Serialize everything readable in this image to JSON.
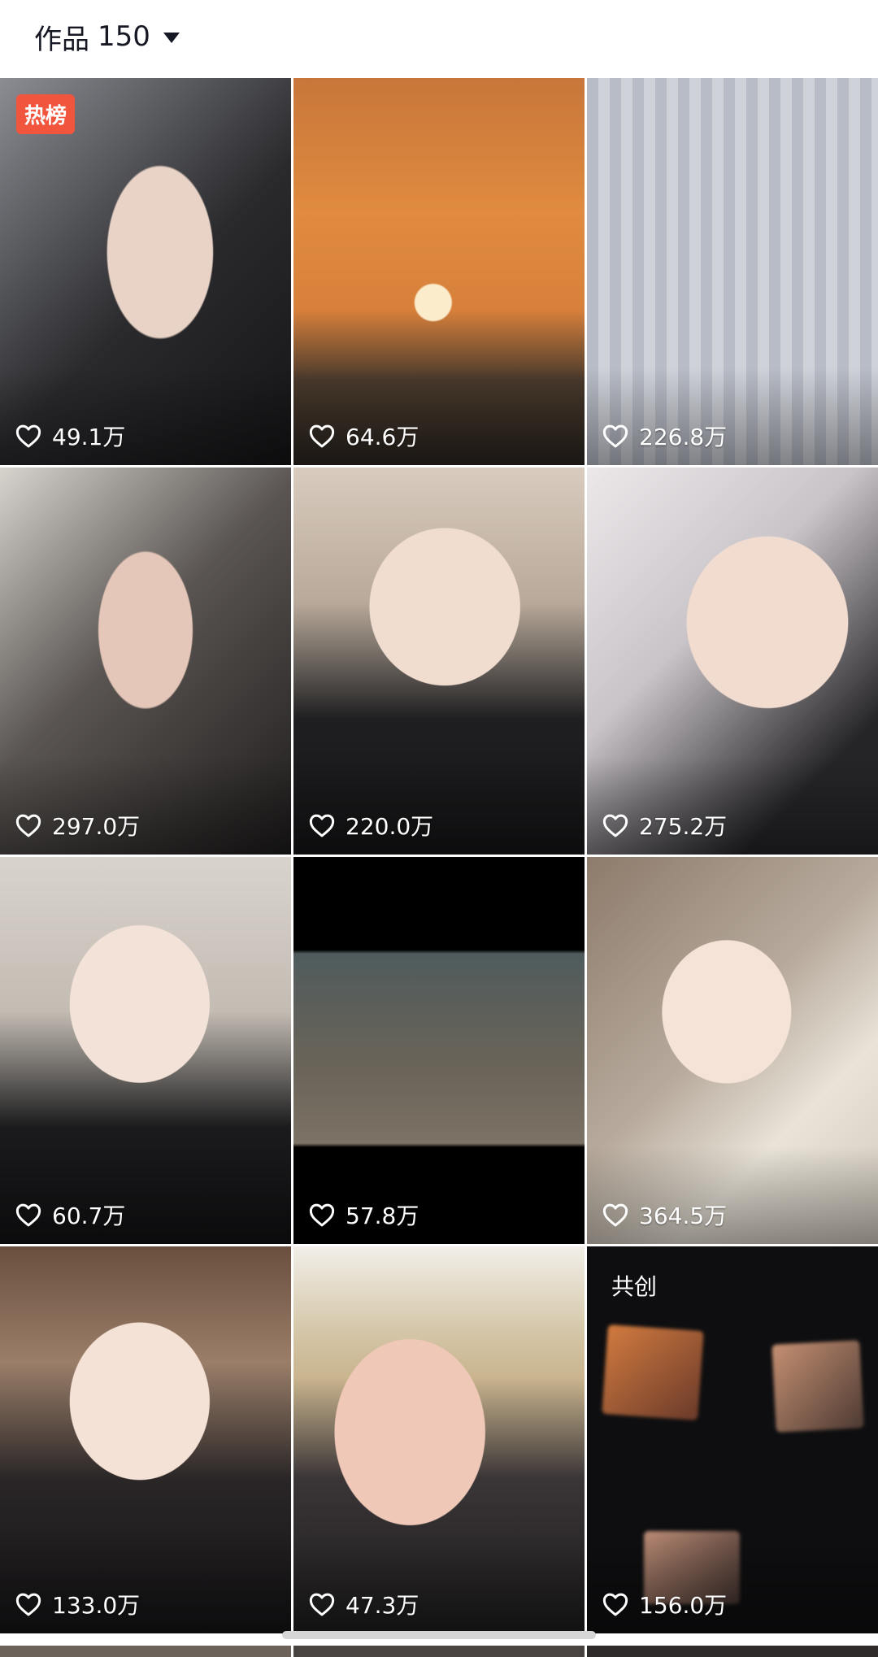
{
  "header": {
    "label": "作品",
    "count": "150",
    "dropdown_icon": "caret-down-icon"
  },
  "grid": {
    "like_icon": "heart-outline-icon",
    "tiles": [
      {
        "likes": "49.1万",
        "badge": "热榜"
      },
      {
        "likes": "64.6万"
      },
      {
        "likes": "226.8万"
      },
      {
        "likes": "297.0万"
      },
      {
        "likes": "220.0万"
      },
      {
        "likes": "275.2万"
      },
      {
        "likes": "60.7万"
      },
      {
        "likes": "57.8万"
      },
      {
        "likes": "364.5万"
      },
      {
        "likes": "133.0万"
      },
      {
        "likes": "47.3万"
      },
      {
        "likes": "156.0万",
        "badge": "共创"
      }
    ]
  },
  "colors": {
    "hot_badge": "#f2553d",
    "text_primary": "#161823"
  }
}
